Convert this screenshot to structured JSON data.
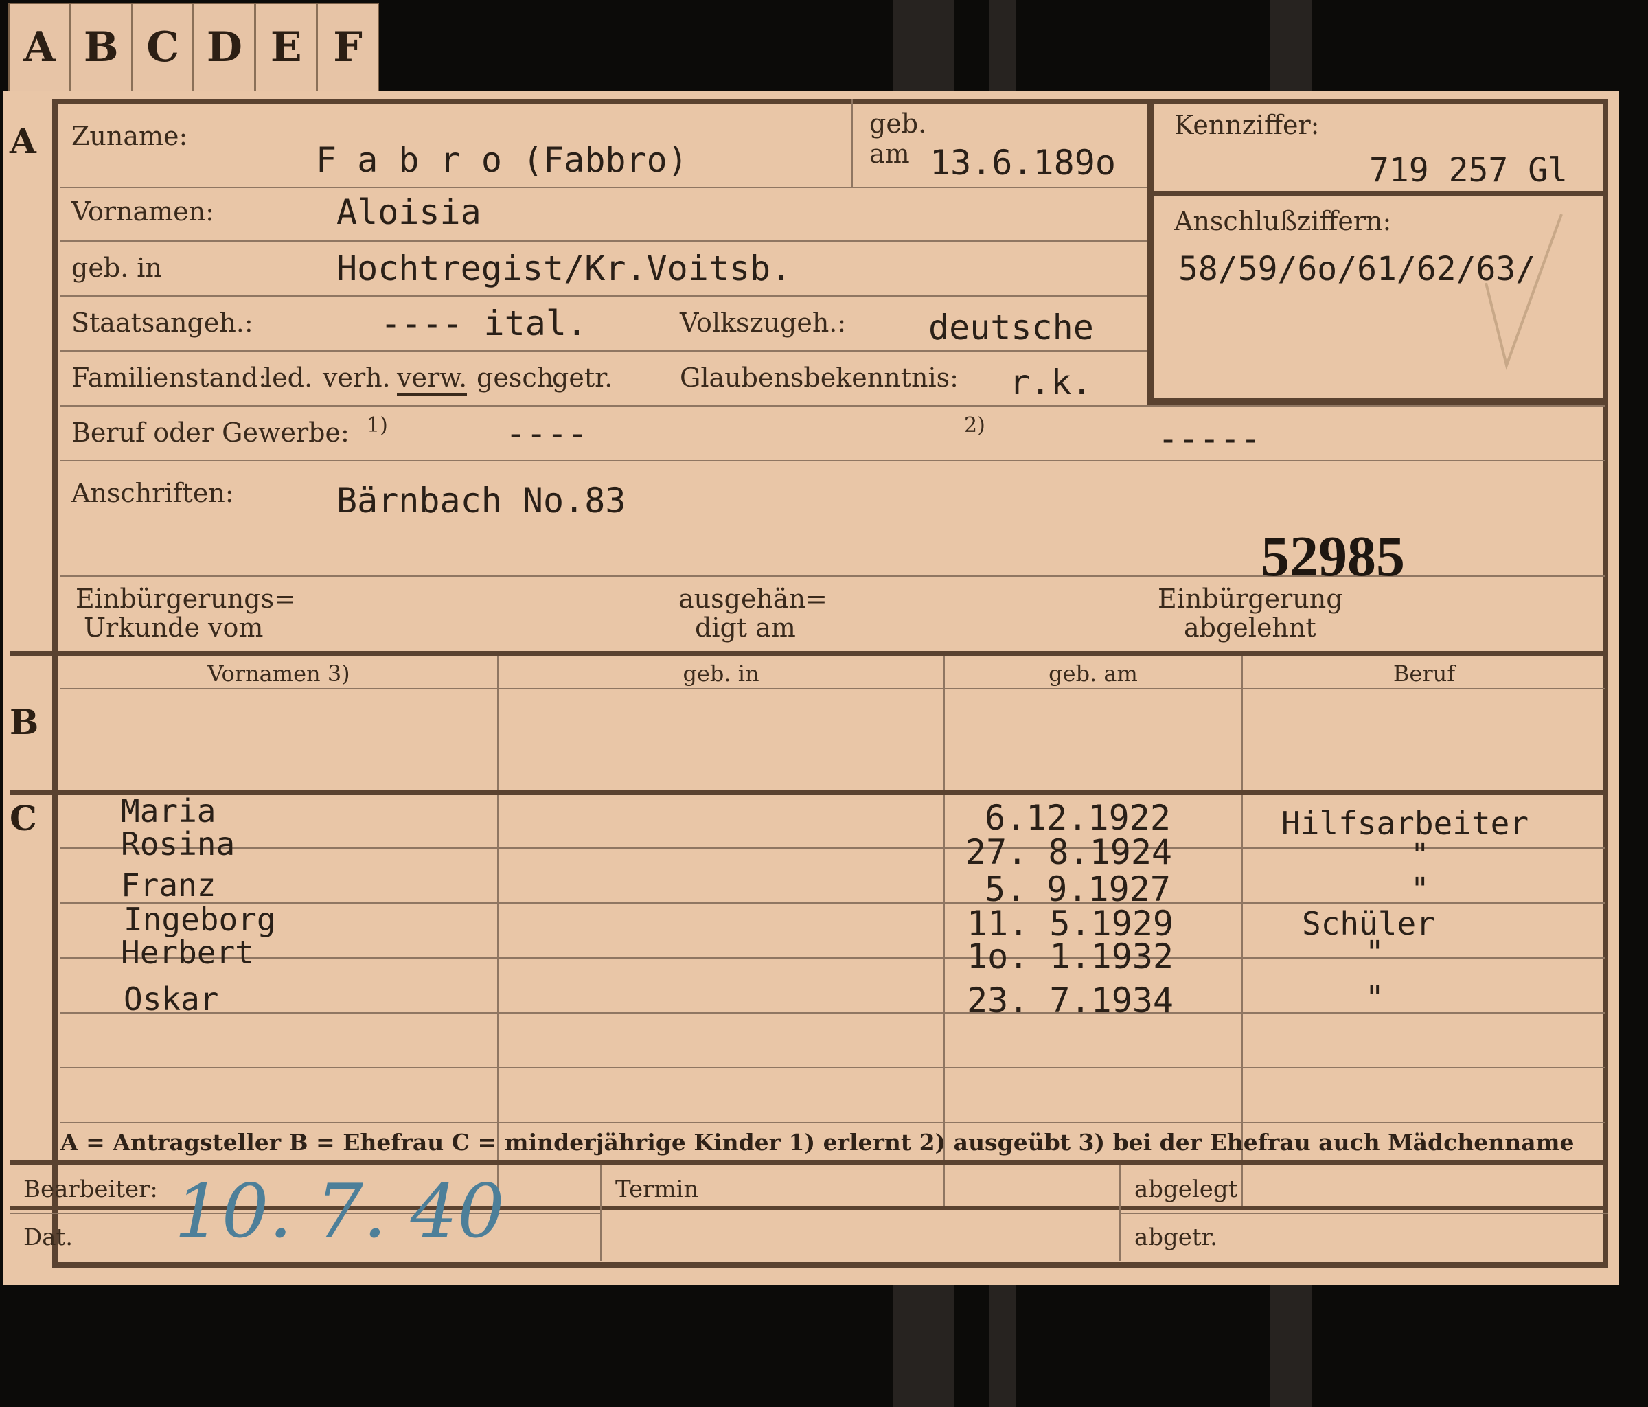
{
  "tabs": [
    "A",
    "B",
    "C",
    "D",
    "E",
    "F"
  ],
  "section_markers": {
    "a": "A",
    "b": "B",
    "c": "C"
  },
  "applicant": {
    "zuname_label": "Zuname:",
    "zuname_value": "F a b r o  (Fabbro)",
    "geb_am_label_1": "geb.",
    "geb_am_label_2": "am",
    "geb_am_value": "13.6.189o",
    "vornamen_label": "Vornamen:",
    "vornamen_value": "Aloisia",
    "geb_in_label": "geb. in",
    "geb_in_value": "Hochtregist/Kr.Voitsb.",
    "staatsangeh_label": "Staatsangeh.:",
    "staatsangeh_value": "---- ital.",
    "volkszugeh_label": "Volkszugeh.:",
    "volkszugeh_value": "deutsche",
    "familienstand_label": "Familienstand:",
    "familienstand_options": [
      "led.",
      "verh.",
      "verw.",
      "gesch.",
      "getr."
    ],
    "familienstand_selected": "verw.",
    "glaubens_label": "Glaubensbekenntnis:",
    "glaubens_value": "r.k.",
    "beruf_label": "Beruf oder Gewerbe:",
    "beruf_note_1": "1)",
    "beruf_value_1": "----",
    "beruf_note_2": "2)",
    "beruf_value_2": "-----",
    "anschriften_label": "Anschriften:",
    "anschriften_value": "Bärnbach No.83",
    "stamp_number": "52985",
    "einb_urkunde_label_1": "Einbürgerungs=",
    "einb_urkunde_label_2": "Urkunde vom",
    "ausgehaendigt_label_1": "ausgehän=",
    "ausgehaendigt_label_2": "digt am",
    "einb_abgelehnt_label_1": "Einbürgerung",
    "einb_abgelehnt_label_2": "abgelehnt"
  },
  "kennziffer": {
    "label": "Kennziffer:",
    "value": "719 257  Gl",
    "anschluss_label": "Anschlußziffern:",
    "anschluss_value": "58/59/6o/61/62/63/"
  },
  "table": {
    "headers": [
      "Vornamen 3)",
      "geb. in",
      "geb. am",
      "Beruf"
    ],
    "children": [
      {
        "vorname": "Maria",
        "geb_am": "6.12.1922",
        "beruf": "Hilfsarbeiter"
      },
      {
        "vorname": "Rosina",
        "geb_am": "27. 8.1924",
        "beruf": "\""
      },
      {
        "vorname": "Franz",
        "geb_am": "5. 9.1927",
        "beruf": "\""
      },
      {
        "vorname": "Ingeborg",
        "geb_am": "11. 5.1929",
        "beruf": "Schüler"
      },
      {
        "vorname": "Herbert",
        "geb_am": "1o. 1.1932",
        "beruf": "\""
      },
      {
        "vorname": "Oskar",
        "geb_am": "23. 7.1934",
        "beruf": "\""
      }
    ]
  },
  "legend": "A = Antragsteller   B = Ehefrau   C = minderjährige Kinder   1) erlernt   2) ausgeübt   3) bei der Ehefrau auch Mädchenname",
  "footer": {
    "bearbeiter_label": "Bearbeiter:",
    "dat_label": "Dat.",
    "dat_value": "10. 7. 40",
    "termin_label": "Termin",
    "abgelegt_label": "abgelegt",
    "abgetr_label": "abgetr."
  }
}
